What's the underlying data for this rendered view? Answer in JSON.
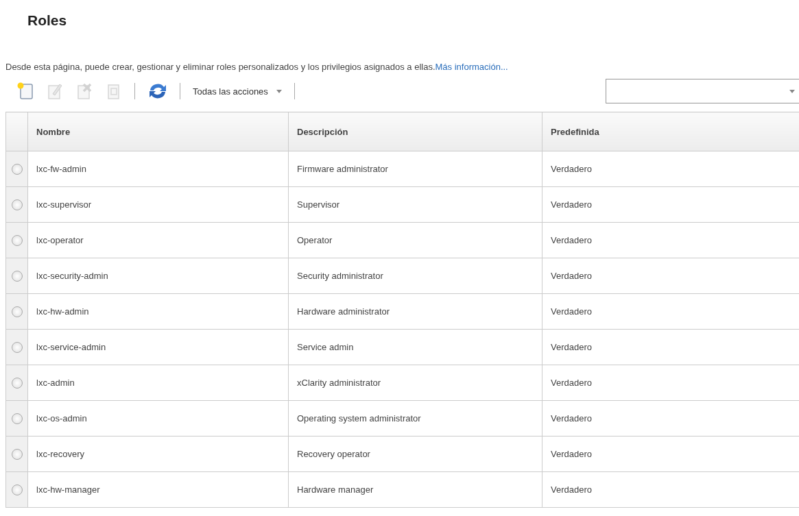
{
  "page": {
    "title": "Roles",
    "description": "Desde esta página, puede crear, gestionar y eliminar roles personalizados y los privilegios asignados a ellas.",
    "link": "Más información..."
  },
  "toolbar": {
    "buttons": [
      {
        "kind": "create",
        "disabled": false
      },
      {
        "kind": "edit",
        "disabled": true
      },
      {
        "kind": "delete",
        "disabled": true
      },
      {
        "kind": "copy",
        "disabled": true
      },
      {
        "kind": "refresh",
        "disabled": false
      }
    ],
    "actions_menu": "Todas las acciones"
  },
  "table": {
    "columns": [
      "Nombre",
      "Descripción",
      "Predefinida"
    ],
    "rows": [
      {
        "name": "lxc-fw-admin",
        "description": "Firmware administrator",
        "predefined": "Verdadero",
        "selected": false
      },
      {
        "name": "lxc-supervisor",
        "description": "Supervisor",
        "predefined": "Verdadero",
        "selected": false
      },
      {
        "name": "lxc-operator",
        "description": "Operator",
        "predefined": "Verdadero",
        "selected": false
      },
      {
        "name": "lxc-security-admin",
        "description": "Security administrator",
        "predefined": "Verdadero",
        "selected": false
      },
      {
        "name": "lxc-hw-admin",
        "description": "Hardware administrator",
        "predefined": "Verdadero",
        "selected": false
      },
      {
        "name": "lxc-service-admin",
        "description": "Service admin",
        "predefined": "Verdadero",
        "selected": false
      },
      {
        "name": "lxc-admin",
        "description": "xClarity administrator",
        "predefined": "Verdadero",
        "selected": false
      },
      {
        "name": "lxc-os-admin",
        "description": "Operating system administrator",
        "predefined": "Verdadero",
        "selected": false
      },
      {
        "name": "lxc-recovery",
        "description": "Recovery operator",
        "predefined": "Verdadero",
        "selected": false
      },
      {
        "name": "lxc-hw-manager",
        "description": "Hardware manager",
        "predefined": "Verdadero",
        "selected": false
      }
    ]
  }
}
